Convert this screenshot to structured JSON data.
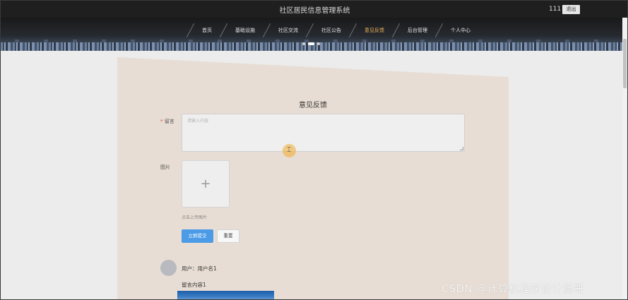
{
  "header": {
    "site_title": "社区居民信息管理系统",
    "user_name": "111",
    "logout_label": "退出"
  },
  "nav": {
    "items": [
      {
        "label": "首页",
        "active": false
      },
      {
        "label": "基础设施",
        "active": false
      },
      {
        "label": "社区交流",
        "active": false
      },
      {
        "label": "社区公告",
        "active": false
      },
      {
        "label": "意见反馈",
        "active": true
      },
      {
        "label": "后台管理",
        "active": false
      },
      {
        "label": "个人中心",
        "active": false
      }
    ]
  },
  "carousel": {
    "dot_count": 3,
    "active_index": 1
  },
  "form": {
    "title": "意见反馈",
    "message_label": "留言",
    "message_required_mark": "*",
    "message_placeholder": "请输入内容",
    "image_label": "图片",
    "upload_icon": "plus-icon",
    "upload_hint": "点击上传图片",
    "submit_label": "立即提交",
    "reset_label": "重置"
  },
  "comment": {
    "user_text": "用户：用户名1",
    "content_text": "留言内容1"
  },
  "cursor": {
    "icon": "text-cursor-icon",
    "highlight_color": "#f0b446"
  },
  "watermark": {
    "text": "CSDN @计算机程序设计源哥"
  },
  "colors": {
    "accent": "#4b9be6",
    "active_nav": "#f0b35b",
    "panel": "#e8ddd4"
  }
}
